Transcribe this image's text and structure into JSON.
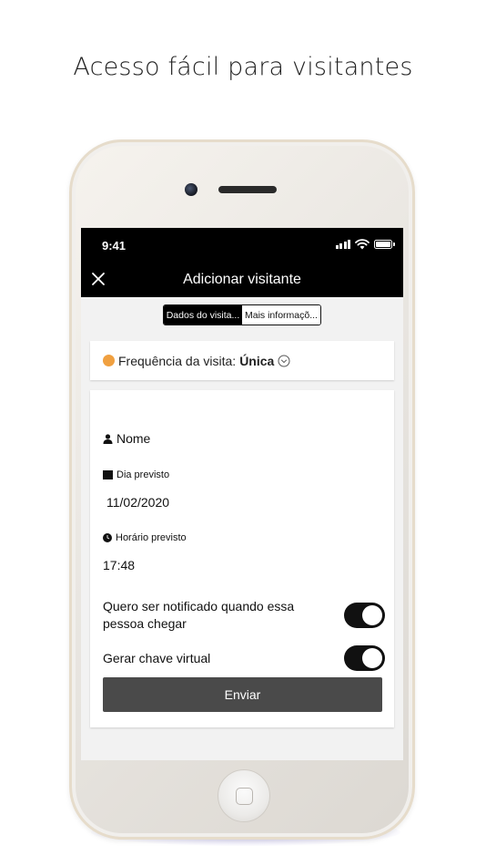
{
  "headline": "Acesso fácil para visitantes",
  "status_bar": {
    "time": "9:41"
  },
  "nav": {
    "title": "Adicionar visitante"
  },
  "tabs": [
    {
      "label": "Dados do visita...",
      "active": true
    },
    {
      "label": "Mais informaçõ...",
      "active": false
    }
  ],
  "frequency": {
    "label": "Frequência da visita",
    "separator": " :",
    "value": "Única"
  },
  "form": {
    "name_label": "Nome",
    "date_label": "Dia previsto",
    "date_value": "11/02/2020",
    "time_label": "Horário previsto",
    "time_value": "17:48",
    "notify_label": "Quero ser notificado quando essa pessoa chegar",
    "notify_on": true,
    "virtual_key_label": "Gerar chave virtual",
    "virtual_key_on": true,
    "submit_label": "Enviar"
  },
  "colors": {
    "accent_orange": "#f0a040",
    "bar_black": "#000000",
    "button_gray": "#4a4a4a"
  }
}
